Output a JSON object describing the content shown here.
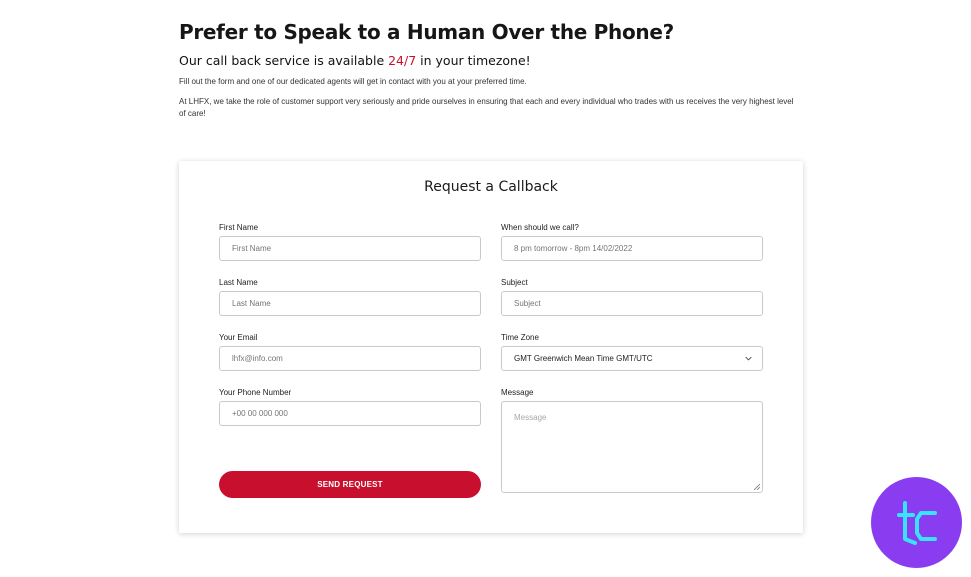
{
  "hero": {
    "title": "Prefer to Speak to a Human Over the Phone?",
    "subtitle_before": "Our call back service is available ",
    "subtitle_accent": "24/7",
    "subtitle_after": " in your timezone!",
    "paragraph1": "Fill out the form and one of our dedicated agents will get in contact with you at your preferred time.",
    "paragraph2": "At LHFX, we take the role of customer support very seriously and pride ourselves in ensuring that each and every individual who trades with us receives the very highest level of care!"
  },
  "form": {
    "title": "Request a Callback",
    "first_name": {
      "label": "First Name",
      "placeholder": "First Name"
    },
    "last_name": {
      "label": "Last Name",
      "placeholder": "Last Name"
    },
    "email": {
      "label": "Your Email",
      "placeholder": "lhfx@info.com"
    },
    "phone": {
      "label": "Your Phone Number",
      "placeholder": "+00 00 000 000"
    },
    "when": {
      "label": "When should we call?",
      "placeholder": "8 pm tomorrow - 8pm 14/02/2022"
    },
    "subject": {
      "label": "Subject",
      "placeholder": "Subject"
    },
    "timezone": {
      "label": "Time Zone",
      "value": "GMT Greenwich Mean Time GMT/UTC"
    },
    "message": {
      "label": "Message",
      "placeholder": "Message"
    },
    "submit_label": "SEND REQUEST"
  },
  "colors": {
    "accent": "#c8102e",
    "logo_bg": "#8a3cf0",
    "logo_mark": "#39e3ff"
  },
  "icons": {
    "select": "chevron-down-icon",
    "resize": "resize-grip-icon",
    "brand": "tc-logo-icon"
  }
}
